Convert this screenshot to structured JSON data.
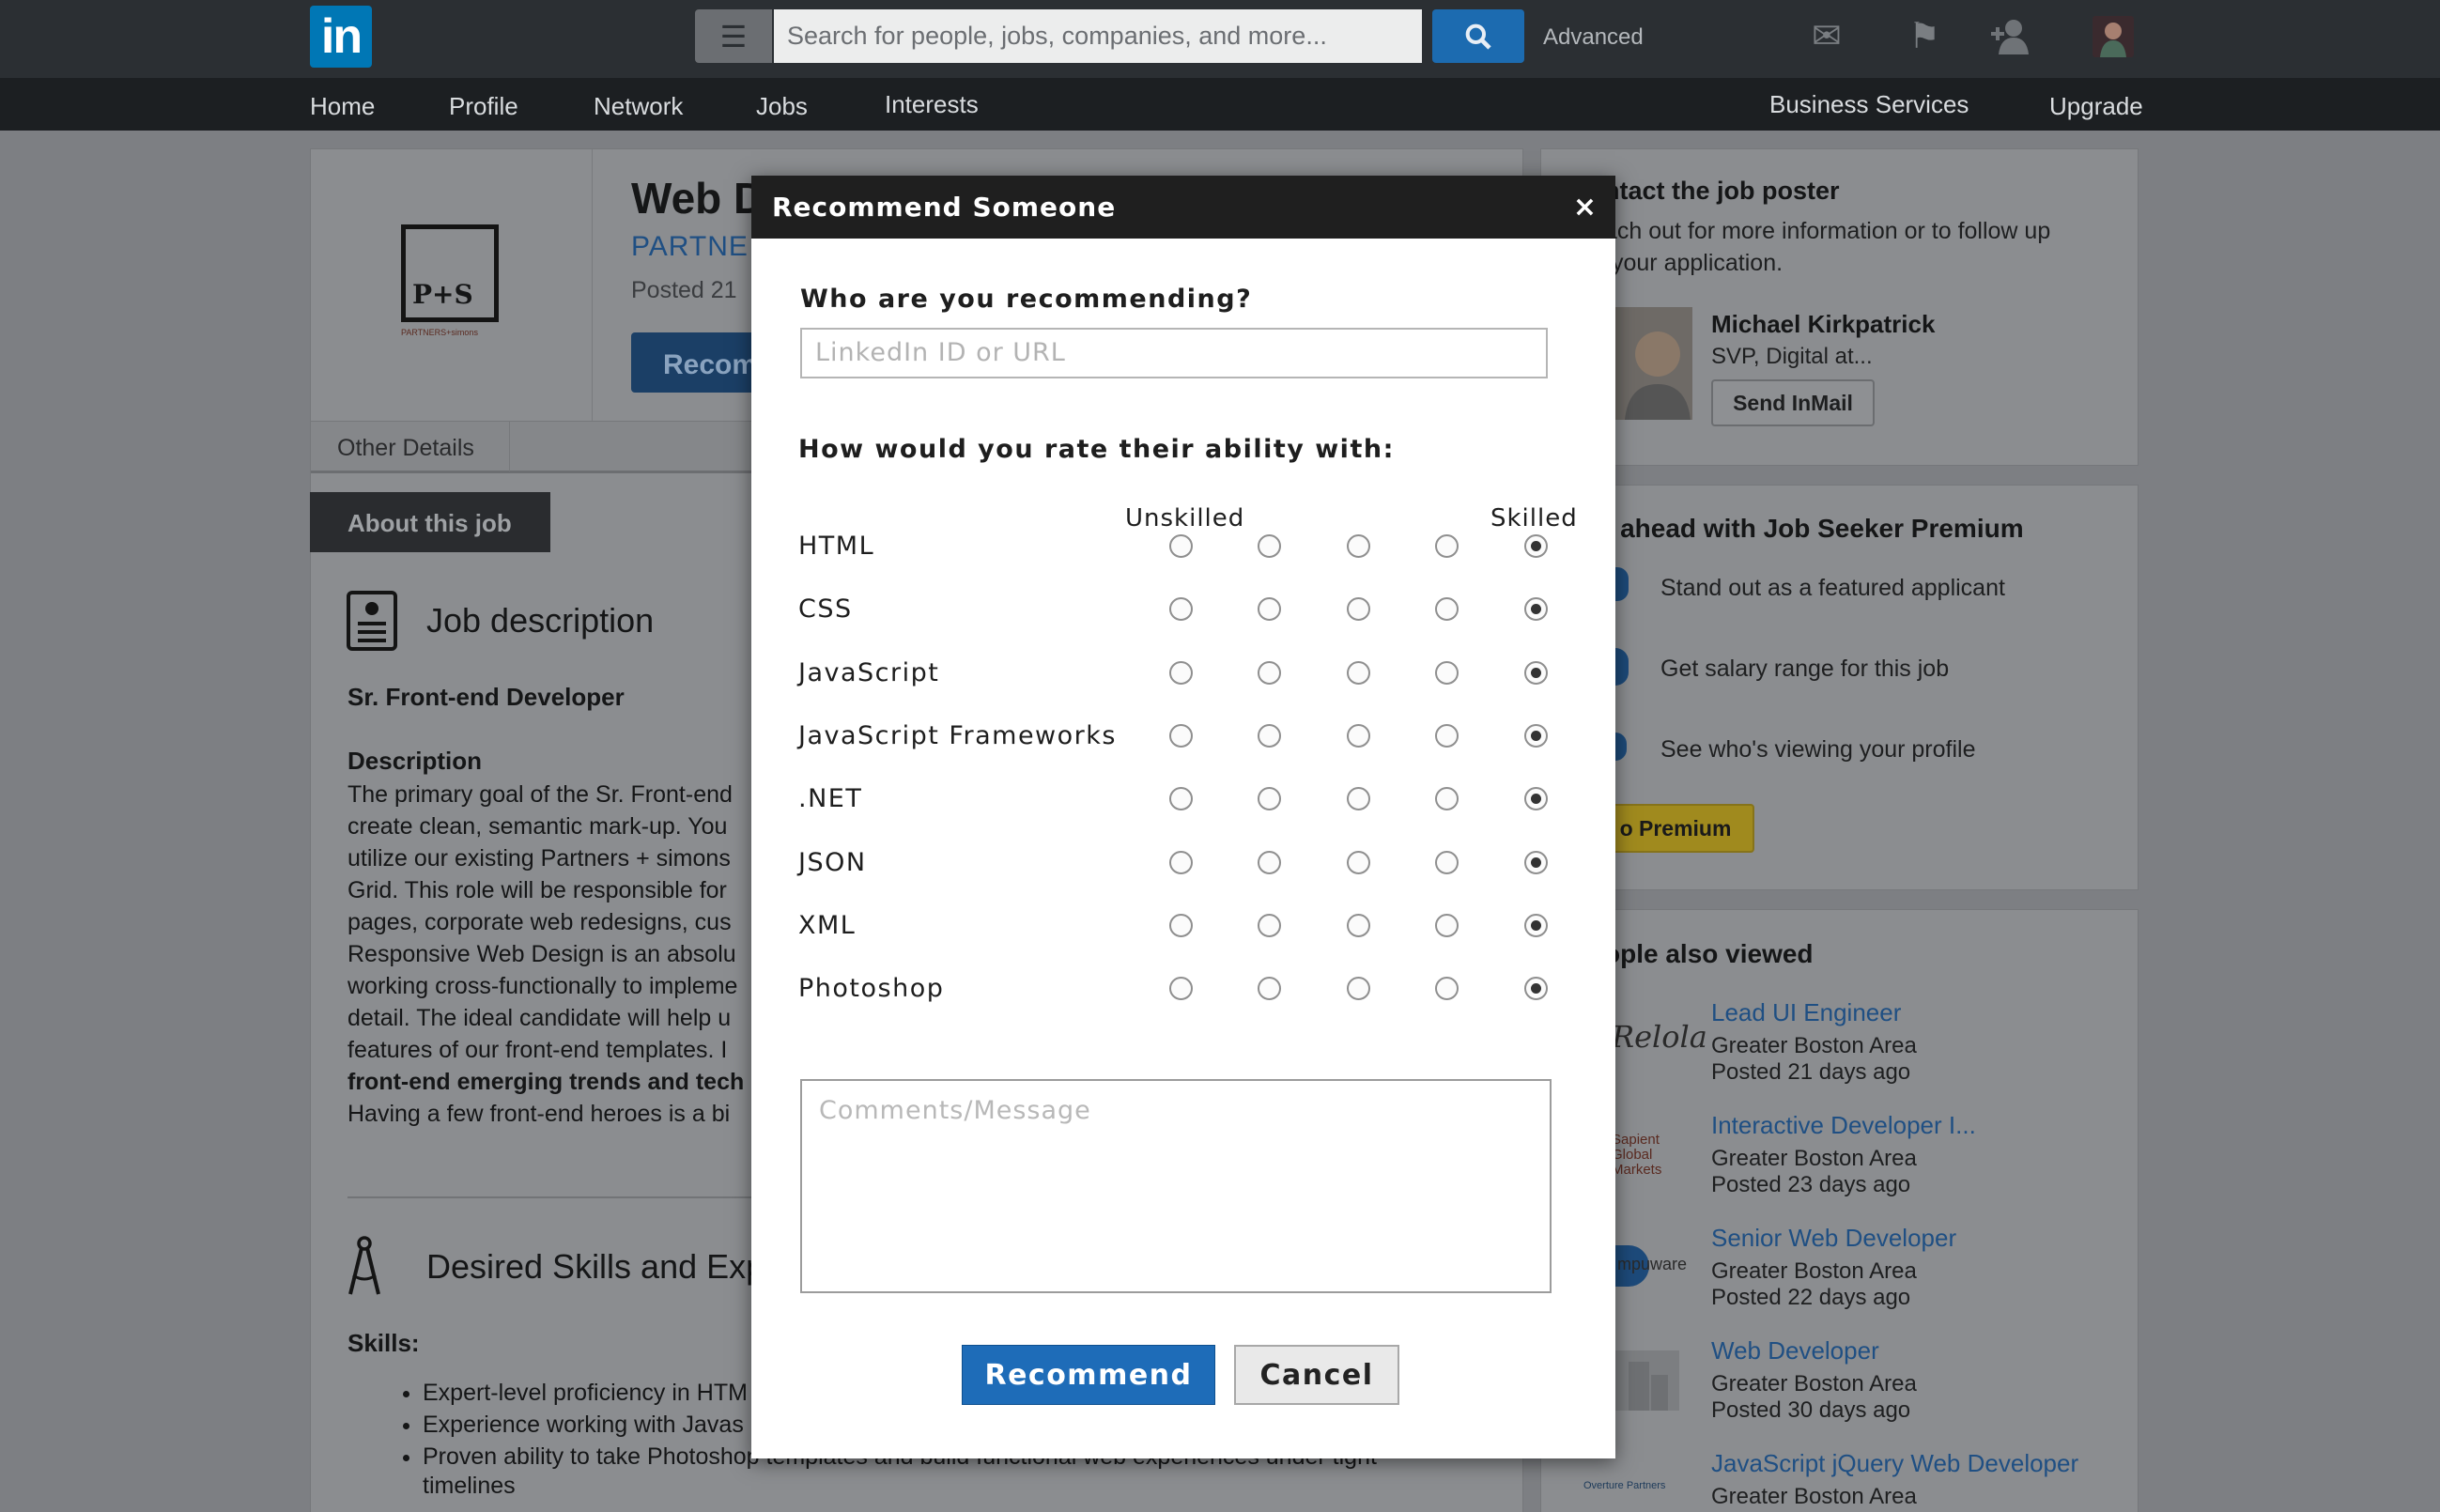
{
  "topbar": {
    "logo": "in",
    "search_placeholder": "Search for people, jobs, companies, and more...",
    "advanced": "Advanced"
  },
  "nav": {
    "items": [
      "Home",
      "Profile",
      "Network",
      "Jobs",
      "Interests"
    ],
    "business": "Business Services",
    "upgrade": "Upgrade"
  },
  "job": {
    "title": "Web D",
    "company": "PARTNE",
    "posted": "Posted 21",
    "recommend_btn": "Recom",
    "logo_text": "P+S",
    "logo_caption": "PARTNERS+simons",
    "tab_other": "Other Details",
    "tab_about": "About this job",
    "desc_heading": "Job description",
    "role": "Sr. Front-end Developer",
    "desc_label": "Description",
    "desc_lines": [
      "The primary goal of the Sr. Front-end",
      "create clean, semantic mark-up. You",
      "utilize our existing Partners + simons",
      "Grid. This role will be responsible for",
      "pages, corporate web redesigns, cus",
      "Responsive Web Design is an absolu",
      "working cross-functionally to impleme",
      "detail. The ideal candidate will help u",
      "features of our front-end templates. I"
    ],
    "desc_bold_line": "front-end emerging trends and tech",
    "desc_last": "Having a few front-end heroes is a bi",
    "skills_heading": "Desired Skills and Exp",
    "skills_label": "Skills:",
    "skills": [
      "Expert-level proficiency in HTM",
      "Experience working with Javas",
      "Proven ability to take Photoshop templates and build functional web experiences under tight"
    ],
    "skills_wrap": "timelines"
  },
  "sidebar": {
    "contact_title": "ntact the job poster",
    "contact_desc_1": "ach out for more information or to follow up",
    "contact_desc_2": "your application.",
    "poster_name": "Michael Kirkpatrick",
    "poster_title": "SVP, Digital at...",
    "send_inmail": "Send InMail",
    "premium_title": "t ahead with Job Seeker Premium",
    "premium_items": [
      "Stand out as a featured applicant",
      "Get salary range for this job",
      "See who's viewing your profile"
    ],
    "premium_btn": "o Premium",
    "also_viewed_title": "ople also viewed",
    "also_viewed": [
      {
        "title": "Lead UI Engineer",
        "location": "Greater Boston Area",
        "posted": "Posted 21 days ago",
        "logo": "Relola"
      },
      {
        "title": "Interactive Developer I...",
        "location": "Greater Boston Area",
        "posted": "Posted 23 days ago",
        "logo": "Sapient Global Markets"
      },
      {
        "title": "Senior Web Developer",
        "location": "Greater Boston Area",
        "posted": "Posted 22 days ago",
        "logo": "mpuware"
      },
      {
        "title": "Web Developer",
        "location": "Greater Boston Area",
        "posted": "Posted 30 days ago",
        "logo": ""
      },
      {
        "title": "JavaScript jQuery Web Developer",
        "location": "Greater Boston Area",
        "posted": "",
        "logo": "Overture Partners"
      }
    ]
  },
  "modal": {
    "title": "Recommend Someone",
    "close": "×",
    "who_label": "Who are you recommending?",
    "who_placeholder": "LinkedIn ID or URL",
    "rate_label": "How would you rate their ability with:",
    "scale_low": "Unskilled",
    "scale_high": "Skilled",
    "skills": [
      {
        "name": "HTML",
        "rating": 5
      },
      {
        "name": "CSS",
        "rating": 5
      },
      {
        "name": "JavaScript",
        "rating": 5
      },
      {
        "name": "JavaScript Frameworks",
        "rating": 5
      },
      {
        "name": ".NET",
        "rating": 5
      },
      {
        "name": "JSON",
        "rating": 5
      },
      {
        "name": "XML",
        "rating": 5
      },
      {
        "name": "Photoshop",
        "rating": 5
      }
    ],
    "comments_placeholder": "Comments/Message",
    "recommend_btn": "Recommend",
    "cancel_btn": "Cancel"
  }
}
